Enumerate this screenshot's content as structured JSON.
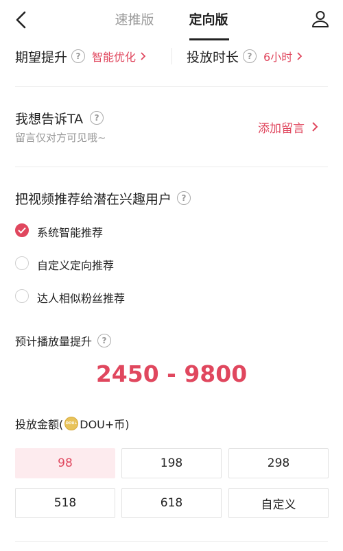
{
  "header": {
    "tabs": [
      {
        "label": "速推版",
        "active": false
      },
      {
        "label": "定向版",
        "active": true
      }
    ]
  },
  "settings": {
    "expect_label": "期望提升",
    "expect_value": "智能优化",
    "duration_label": "投放时长",
    "duration_value": "6小时"
  },
  "message": {
    "title": "我想告诉TA",
    "subtitle": "留言仅对方可见哦~",
    "action": "添加留言"
  },
  "targeting": {
    "title": "把视频推荐给潜在兴趣用户",
    "options": [
      {
        "label": "系统智能推荐",
        "checked": true
      },
      {
        "label": "自定义定向推荐",
        "checked": false
      },
      {
        "label": "达人相似粉丝推荐",
        "checked": false
      }
    ]
  },
  "estimate": {
    "title": "预计播放量提升",
    "range": "2450 - 9800"
  },
  "amount": {
    "title_prefix": "投放金额(",
    "title_suffix": "DOU+币)",
    "coin_text": "DOU+",
    "options": [
      "98",
      "198",
      "298",
      "518",
      "618",
      "自定义"
    ],
    "selected_index": 0
  },
  "colors": {
    "accent": "#e0475e",
    "selected_bg": "#fdebee",
    "coin": "#e8c35a"
  },
  "icons": {
    "back": "chevron-left-icon",
    "user": "user-icon",
    "help": "question-circle-icon",
    "arrow": "chevron-right-icon",
    "check": "check-icon",
    "coin": "dou-coin-icon"
  }
}
